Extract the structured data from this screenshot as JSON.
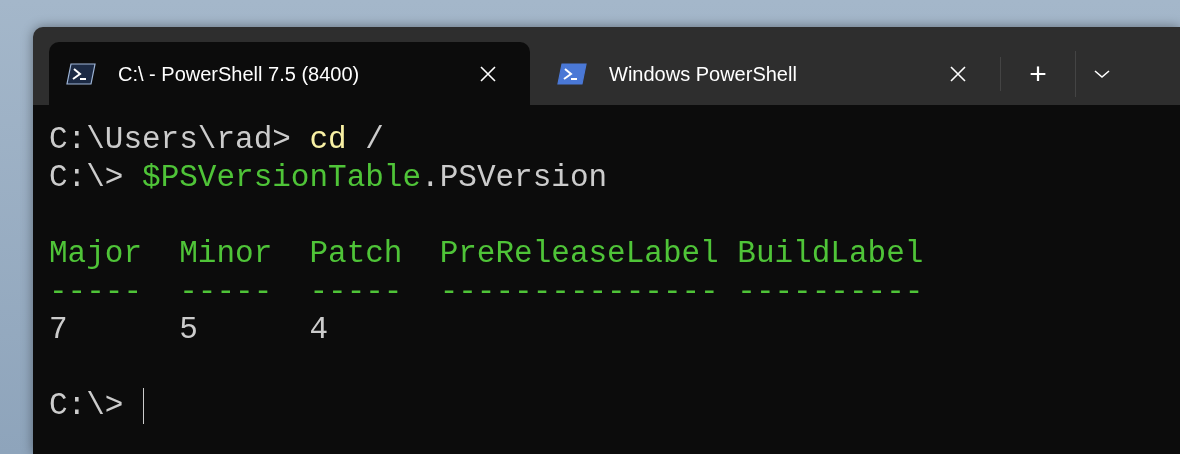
{
  "tabs": [
    {
      "title": "C:\\ - PowerShell 7.5 (8400)",
      "selected": true,
      "color": "#1c2a44"
    },
    {
      "title": "Windows PowerShell",
      "selected": false,
      "color": "#4a78d6"
    }
  ],
  "tab_actions": {
    "new_tab": "+"
  },
  "terminal": {
    "lines": [
      {
        "kind": "text",
        "segments": [
          {
            "text": "C:\\Users\\rad>",
            "kind": "plain"
          },
          {
            "text": " cd",
            "kind": "command"
          },
          {
            "text": " /",
            "kind": "plain"
          }
        ]
      },
      {
        "kind": "text",
        "segments": [
          {
            "text": "C:\\>",
            "kind": "plain"
          },
          {
            "text": " $PSVersionTable",
            "kind": "variable"
          },
          {
            "text": ".PSVersion",
            "kind": "plain"
          }
        ]
      },
      {
        "kind": "blank"
      },
      {
        "kind": "text",
        "segments": [
          {
            "text": "Major  Minor  Patch  PreReleaseLabel BuildLabel",
            "kind": "header"
          }
        ]
      },
      {
        "kind": "text",
        "segments": [
          {
            "text": "-----  -----  -----  --------------- ----------",
            "kind": "header"
          }
        ]
      },
      {
        "kind": "text",
        "segments": [
          {
            "text": "7      5      4",
            "kind": "plain"
          }
        ]
      },
      {
        "kind": "blank"
      },
      {
        "kind": "input",
        "segments": [
          {
            "text": "C:\\>",
            "kind": "plain"
          }
        ]
      }
    ]
  }
}
